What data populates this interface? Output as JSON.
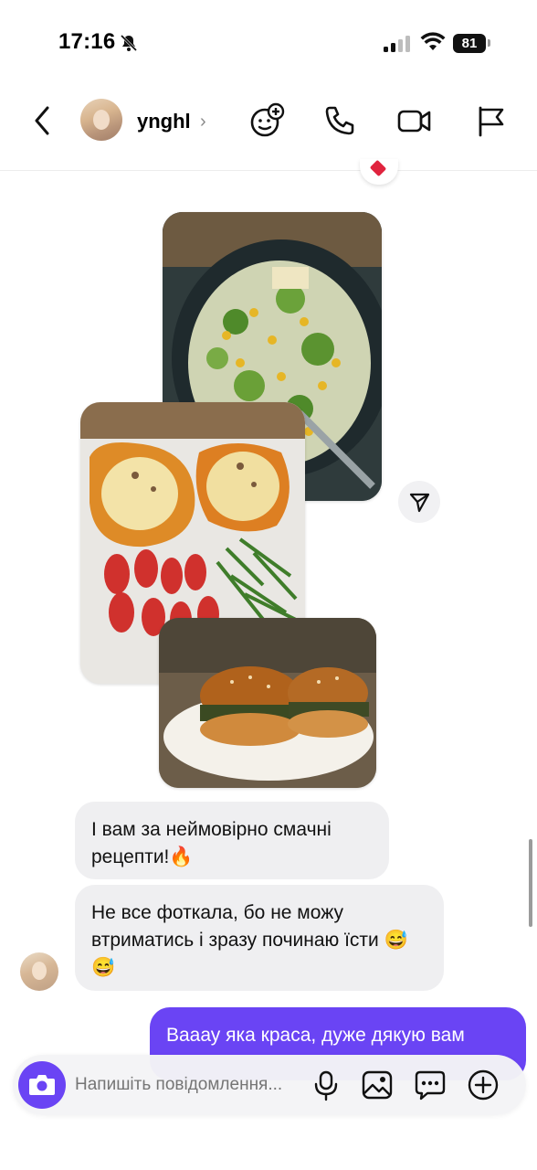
{
  "status_bar": {
    "time": "17:16",
    "battery": "81"
  },
  "header": {
    "username": "ynghl",
    "chevron": "›"
  },
  "messages": {
    "incoming_1": "І вам за неймовірно смачні рецепти!🔥",
    "incoming_2": "Не все фоткала, бо не можу втриматись і зразу починаю їсти 😅😅",
    "outgoing_1": "Вааау яка краса, дуже дякую вам"
  },
  "composer": {
    "placeholder": "Напишіть повідомлення..."
  },
  "colors": {
    "accent": "#6a44f4",
    "bubble_gray": "#efeff1",
    "heart": "#e0233e"
  },
  "icons": [
    "back-arrow-icon",
    "emoji-add-icon",
    "phone-icon",
    "video-icon",
    "flag-icon",
    "share-icon",
    "camera-icon",
    "microphone-icon",
    "gallery-icon",
    "sticker-icon",
    "plus-icon"
  ]
}
